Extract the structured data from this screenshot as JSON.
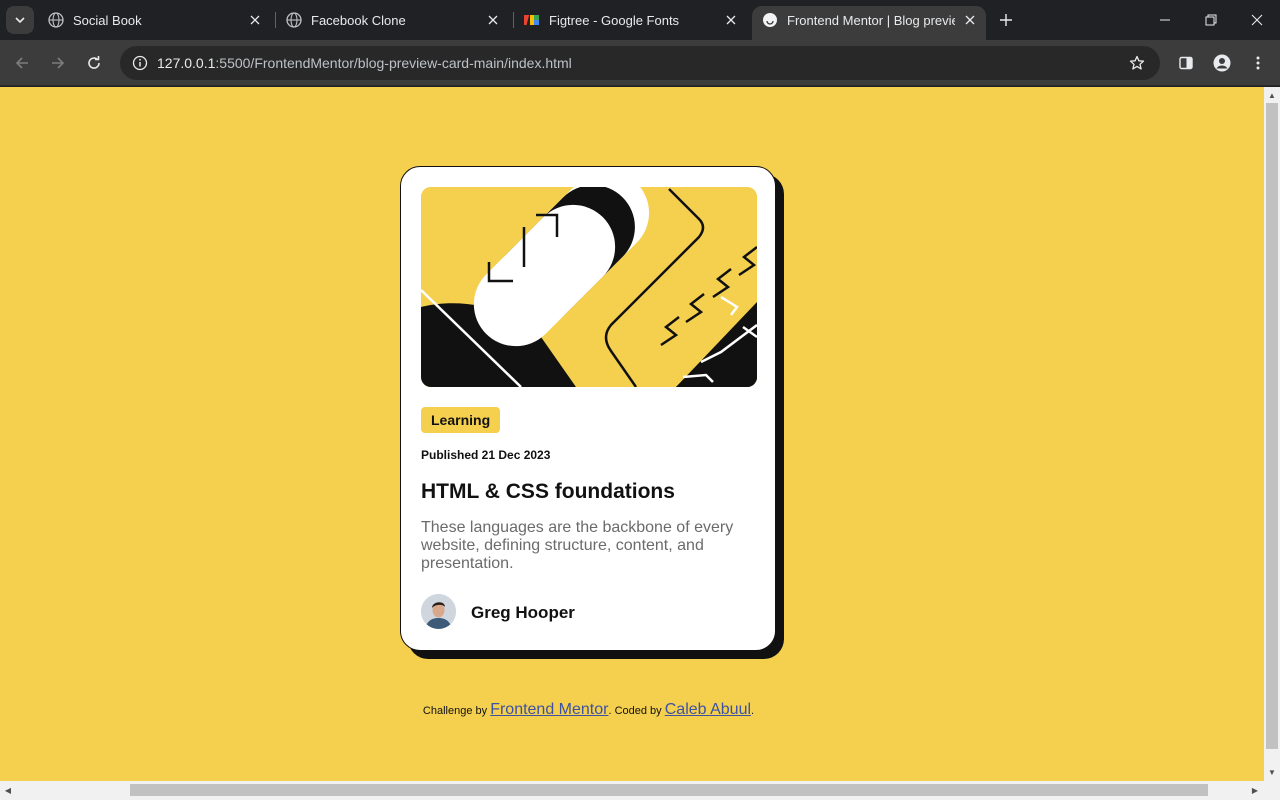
{
  "browser": {
    "tabs": [
      {
        "title": "Social Book",
        "favicon": "globe-icon",
        "active": false
      },
      {
        "title": "Facebook Clone",
        "favicon": "globe-icon",
        "active": false
      },
      {
        "title": "Figtree - Google Fonts",
        "favicon": "google-fonts-icon",
        "active": false
      },
      {
        "title": "Frontend Mentor | Blog preview",
        "favicon": "frontend-mentor-icon",
        "active": true
      }
    ],
    "url_host": "127.0.0.1",
    "url_rest": ":5500/FrontendMentor/blog-preview-card-main/index.html"
  },
  "card": {
    "tag": "Learning",
    "published": "Published 21 Dec 2023",
    "title": "HTML & CSS foundations",
    "description": "These languages are the backbone of every website, defining structure, content, and presentation.",
    "author": "Greg Hooper"
  },
  "attribution": {
    "prefix": "Challenge by",
    "link1": "Frontend Mentor",
    "middle": ". Coded by",
    "link2": "Caleb Abuul",
    "suffix": "."
  },
  "colors": {
    "background": "#f4d04e",
    "card": "#ffffff",
    "ink": "#111111",
    "link": "#3e52a3"
  }
}
